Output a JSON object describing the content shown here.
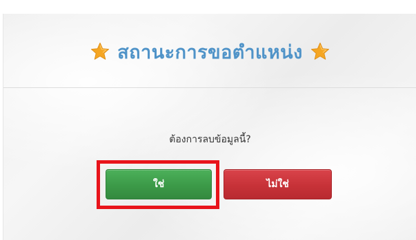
{
  "dialog": {
    "title": "สถานะการขอตำแหน่ง",
    "title_icon_left": "star-icon",
    "title_icon_right": "star-icon",
    "question": "ต้องการลบข้อมูลนี้?",
    "buttons": {
      "yes_label": "ใช่",
      "no_label": "ไม่ใช่"
    }
  },
  "colors": {
    "title": "#4f93c8",
    "star": "#f5a623",
    "yes_button": "#3c9a48",
    "no_button": "#c73238",
    "highlight": "#e8141b"
  }
}
